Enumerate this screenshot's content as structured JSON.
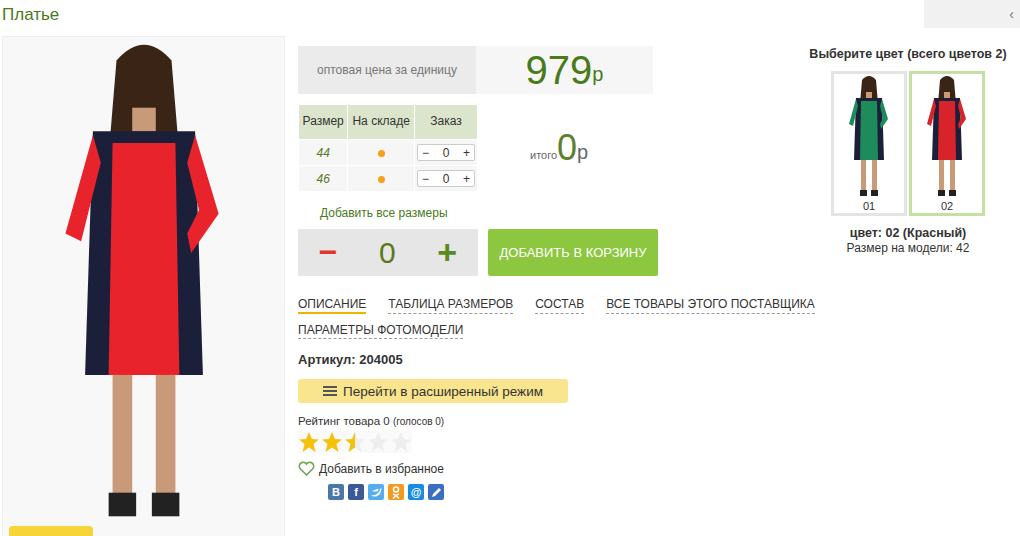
{
  "page": {
    "title": "Платье",
    "back": "‹"
  },
  "price": {
    "label": "оптовая цена за единицу",
    "value": "979",
    "currency": "р"
  },
  "size_table": {
    "columns": [
      "Размер",
      "На складе",
      "Заказ"
    ],
    "rows": [
      {
        "size": "44",
        "in_stock": true,
        "minus": "−",
        "qty": "0",
        "plus": "+"
      },
      {
        "size": "46",
        "in_stock": true,
        "minus": "−",
        "qty": "0",
        "plus": "+"
      }
    ]
  },
  "total": {
    "label": "итого",
    "value": "0",
    "currency": "р"
  },
  "add_all_sizes": "Добавить все размеры",
  "quantity": {
    "minus": "−",
    "value": "0",
    "plus": "+"
  },
  "add_to_cart": "ДОБАВИТЬ В КОРЗИНУ",
  "tabs": [
    {
      "label": "ОПИСАНИЕ",
      "selected": true
    },
    {
      "label": "ТАБЛИЦА РАЗМЕРОВ",
      "selected": false
    },
    {
      "label": "СОСТАВ",
      "selected": false
    },
    {
      "label": "ВСЕ ТОВАРЫ ЭТОГО ПОСТАВЩИКА",
      "selected": false
    },
    {
      "label": "ПАРАМЕТРЫ ФОТОМОДЕЛИ",
      "selected": false
    }
  ],
  "article": "Артикул: 204005",
  "advanced_mode": "Перейти в расширенный режим",
  "rating": {
    "label": "Рейтинг товара 0",
    "votes": "(голосов 0)",
    "stars": 2.5
  },
  "favorite": "Добавить в избранное",
  "share": [
    {
      "kind": "letter",
      "label": "В",
      "color": "#4a76a8"
    },
    {
      "kind": "letter",
      "label": "f",
      "color": "#3b5998"
    },
    {
      "kind": "twitter",
      "color": "#55acee"
    },
    {
      "kind": "ok",
      "color": "#f59a1d"
    },
    {
      "kind": "letter",
      "label": "@",
      "color": "#168de2"
    },
    {
      "kind": "pen",
      "color": "#3a6fc4"
    }
  ],
  "colors": {
    "title": "Выберите цвет (всего цветов 2)",
    "options": [
      {
        "label": "01",
        "selected": false,
        "color": "#1e8c5a"
      },
      {
        "label": "02",
        "selected": true,
        "color": "#d8232a"
      }
    ],
    "current": "цвет: 02 (Красный)",
    "model_size": "Размер на модели: 42"
  }
}
